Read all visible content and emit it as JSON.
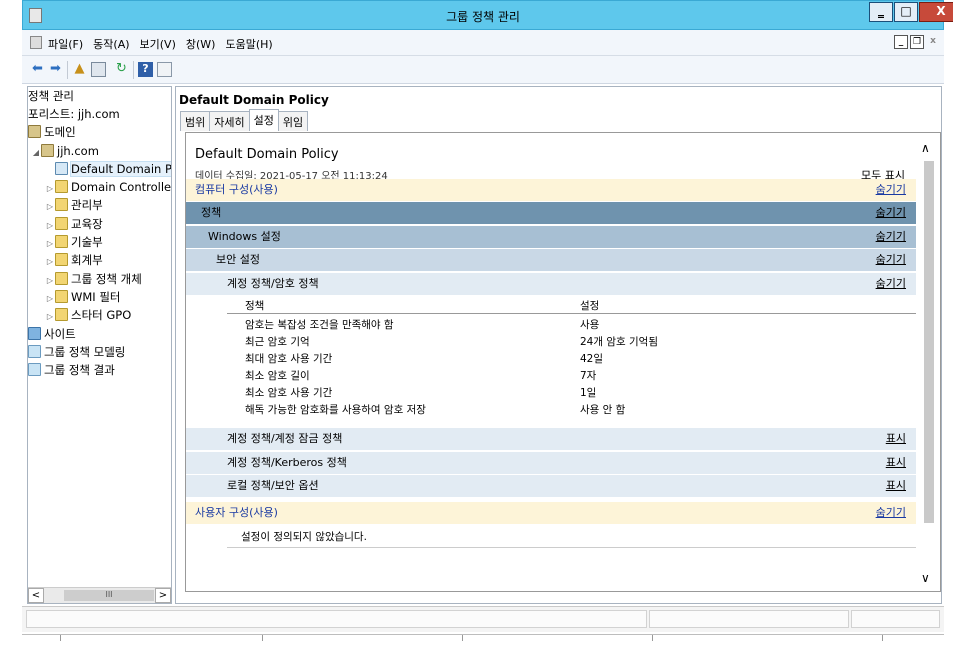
{
  "window": {
    "title": "그룹 정책 관리"
  },
  "menu": {
    "items": [
      "파일(F)",
      "동작(A)",
      "보기(V)",
      "창(W)",
      "도움말(H)"
    ]
  },
  "tree": {
    "items": [
      {
        "label": "정책 관리",
        "indent": 0,
        "icon": "doc",
        "exp": ""
      },
      {
        "label": "포리스트: jjh.com",
        "indent": 0,
        "icon": "",
        "exp": ""
      },
      {
        "label": "도메인",
        "indent": 0,
        "icon": "domain",
        "exp": ""
      },
      {
        "label": "jjh.com",
        "indent": 1,
        "icon": "domain",
        "exp": "◢"
      },
      {
        "label": "Default Domain Policy",
        "indent": 2,
        "icon": "gpo",
        "exp": ""
      },
      {
        "label": "Domain Controllers",
        "indent": 2,
        "icon": "folder",
        "exp": "▷"
      },
      {
        "label": "관리부",
        "indent": 2,
        "icon": "folder",
        "exp": "▷"
      },
      {
        "label": "교육장",
        "indent": 2,
        "icon": "folder",
        "exp": "▷"
      },
      {
        "label": "기술부",
        "indent": 2,
        "icon": "folder",
        "exp": "▷"
      },
      {
        "label": "회계부",
        "indent": 2,
        "icon": "folder",
        "exp": "▷"
      },
      {
        "label": "그룹 정책 개체",
        "indent": 2,
        "icon": "folder",
        "exp": "▷"
      },
      {
        "label": "WMI 필터",
        "indent": 2,
        "icon": "folder",
        "exp": "▷"
      },
      {
        "label": "스타터 GPO",
        "indent": 2,
        "icon": "folder",
        "exp": "▷"
      },
      {
        "label": "사이트",
        "indent": 0,
        "icon": "site",
        "exp": ""
      },
      {
        "label": "그룹 정책 모델링",
        "indent": 0,
        "icon": "model",
        "exp": ""
      },
      {
        "label": "그룹 정책 결과",
        "indent": 0,
        "icon": "model",
        "exp": ""
      }
    ],
    "scroll_thumb": "III"
  },
  "right": {
    "title": "Default Domain Policy",
    "tabs": [
      "범위",
      "자세히",
      "설정",
      "위임"
    ],
    "report": {
      "title": "Default Domain Policy",
      "date": "데이터 수집일: 2021-05-17 오전 11:13:24",
      "show_all": "모두 표시",
      "computer": {
        "label": "컴퓨터 구성(사용)",
        "action": "숨기기"
      },
      "policy": {
        "label": "정책",
        "action": "숨기기"
      },
      "windows": {
        "label": "Windows 설정",
        "action": "숨기기"
      },
      "security": {
        "label": "보안 설정",
        "action": "숨기기"
      },
      "account": {
        "label": "계정 정책/암호 정책",
        "action": "숨기기"
      },
      "table": {
        "headers": [
          "정책",
          "설정"
        ],
        "rows": [
          [
            "암호는 복잡성 조건을 만족해야 함",
            "사용"
          ],
          [
            "최근 암호 기억",
            "24개 암호 기억됨"
          ],
          [
            "최대 암호 사용 기간",
            "42일"
          ],
          [
            "최소 암호 길이",
            "7자"
          ],
          [
            "최소 암호 사용 기간",
            "1일"
          ],
          [
            "해독 가능한 암호화를 사용하여 암호 저장",
            "사용 안 함"
          ]
        ]
      },
      "lockout": {
        "label": "계정 정책/계정 잠금 정책",
        "action": "표시"
      },
      "kerberos": {
        "label": "계정 정책/Kerberos 정책",
        "action": "표시"
      },
      "local": {
        "label": "로컬 정책/보안 옵션",
        "action": "표시"
      },
      "user": {
        "label": "사용자 구성(사용)",
        "action": "숨기기"
      },
      "undefined": "설정이 정의되지 않았습니다."
    }
  }
}
